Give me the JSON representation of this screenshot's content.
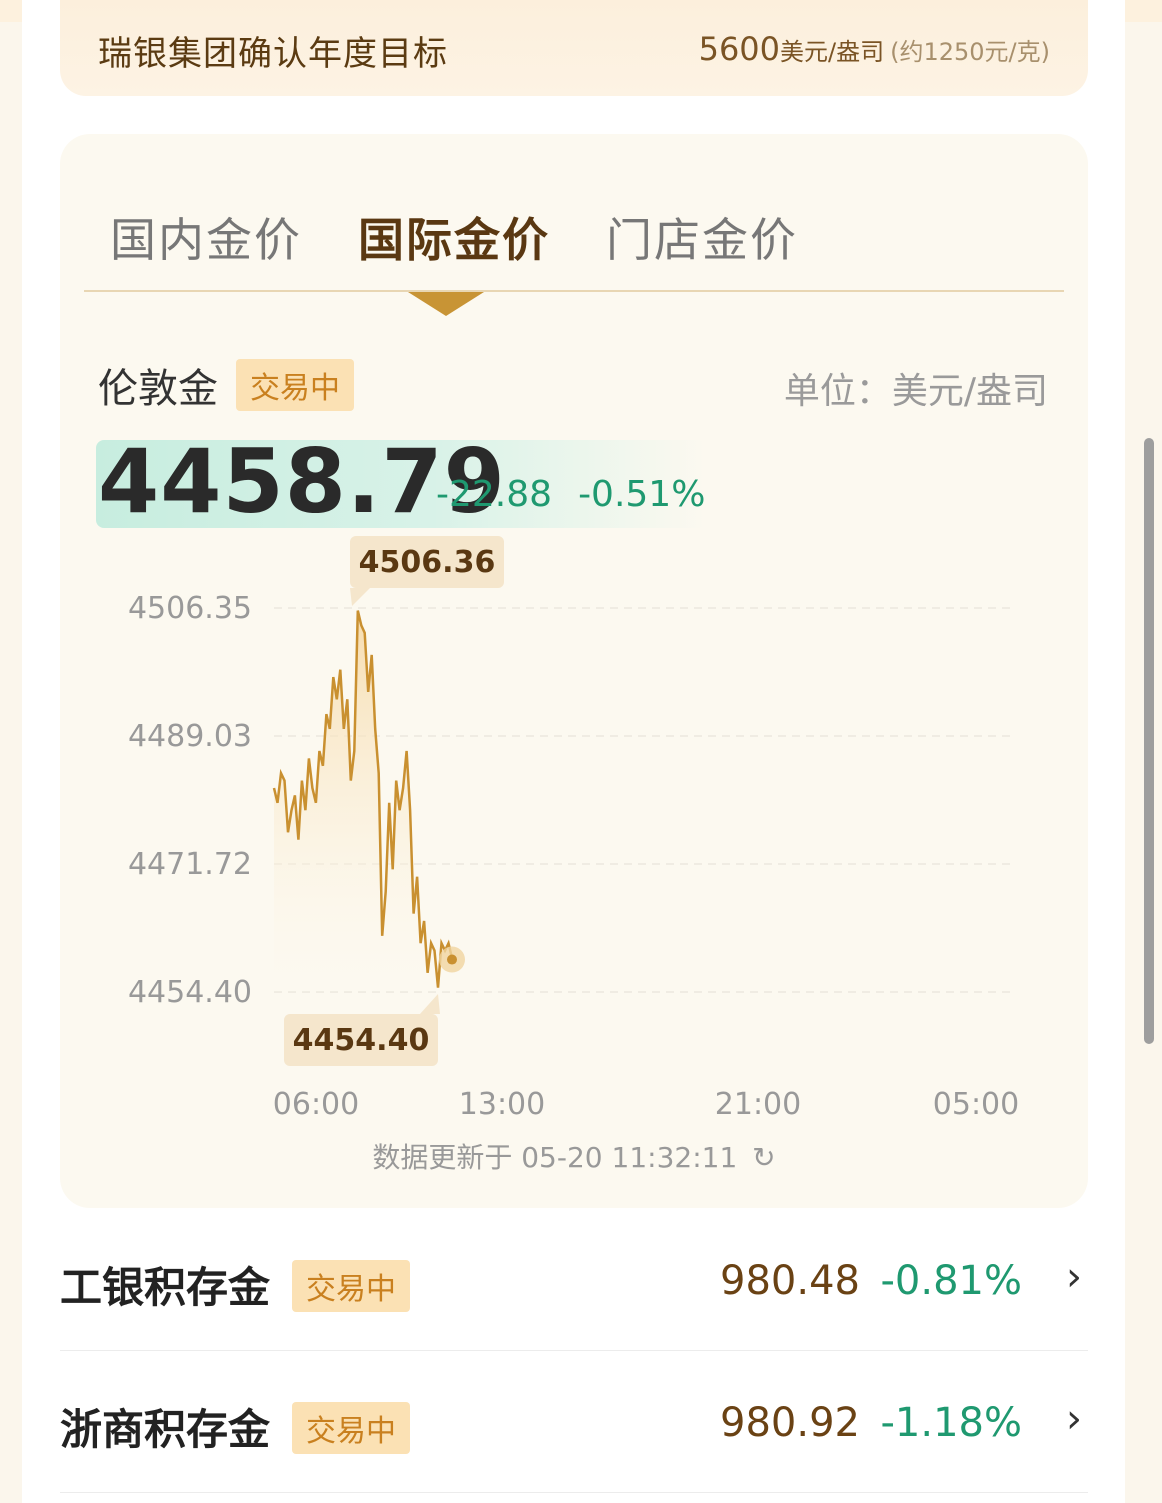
{
  "target": {
    "title": "瑞银集团确认年度目标",
    "value": "5600",
    "unit": "美元/盎司",
    "approx": "(约1250元/克)"
  },
  "tabs": [
    {
      "label": "国内金价",
      "active": false
    },
    {
      "label": "国际金价",
      "active": true
    },
    {
      "label": "门店金价",
      "active": false
    }
  ],
  "market": {
    "name": "伦敦金",
    "status": "交易中",
    "unit_label": "单位：美元/盎司",
    "price": "4458.79",
    "change": "-22.88",
    "change_pct": "-0.51%"
  },
  "chart_data": {
    "type": "line",
    "y_ticks": [
      "4506.35",
      "4489.03",
      "4471.72",
      "4454.40"
    ],
    "x_ticks": [
      "06:00",
      "13:00",
      "21:00",
      "05:00"
    ],
    "ylim": [
      4454.4,
      4506.35
    ],
    "max_label": "4506.36",
    "min_label": "4454.40",
    "series": [
      {
        "values": [
          4482,
          4480,
          4484,
          4483,
          4476,
          4479,
          4481,
          4475,
          4483,
          4479,
          4486,
          4482,
          4480,
          4487,
          4485,
          4492,
          4490,
          4497,
          4494,
          4498,
          4490,
          4494,
          4483,
          4487,
          4506,
          4504,
          4503,
          4495,
          4500,
          4490,
          4484,
          4462,
          4468,
          4480,
          4471,
          4483,
          4479,
          4482,
          4487,
          4479,
          4465,
          4470,
          4461,
          4464,
          4457,
          4461,
          4460,
          4455,
          4461,
          4460,
          4461,
          4459
        ],
        "last": 4458.79
      }
    ],
    "color": "#c99030",
    "update_text": "数据更新于 05-20 11:32:11",
    "refresh_icon": "refresh-icon"
  },
  "list": [
    {
      "name": "工银积存金",
      "status": "交易中",
      "value": "980.48",
      "pct": "-0.81%"
    },
    {
      "name": "浙商积存金",
      "status": "交易中",
      "value": "980.92",
      "pct": "-1.18%"
    }
  ],
  "colors": {
    "accent": "#c89435",
    "down": "#1f9970",
    "badge_bg": "#fbe1b4",
    "badge_text": "#c9801f"
  }
}
